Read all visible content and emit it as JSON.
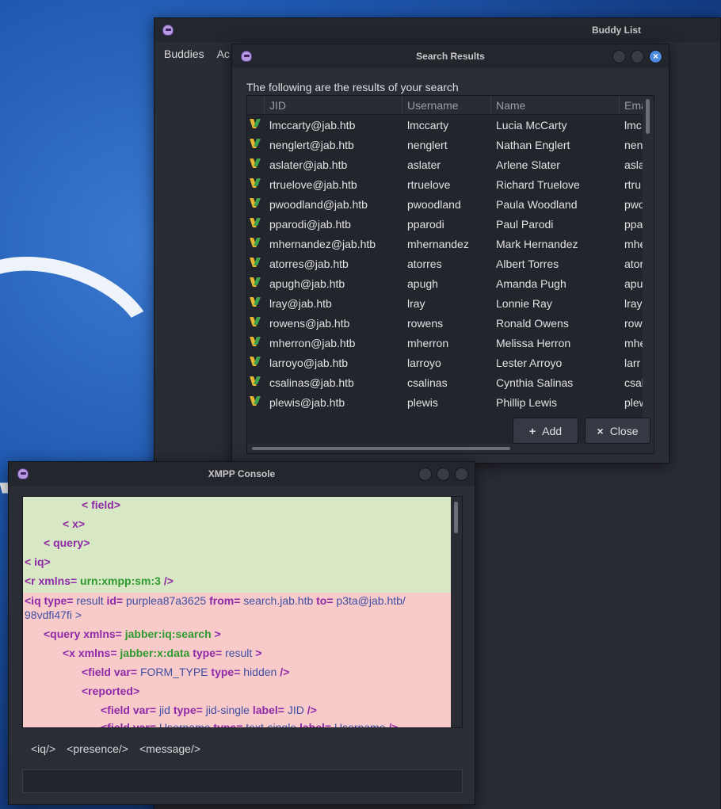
{
  "buddy_window": {
    "title": "Buddy List",
    "menu": [
      "Buddies",
      "Ac"
    ]
  },
  "search_window": {
    "title": "Search Results",
    "caption": "The following are the results of your search",
    "columns": [
      "JID",
      "Username",
      "Name",
      "Ema"
    ],
    "rows": [
      {
        "jid": "lmccarty@jab.htb",
        "username": "lmccarty",
        "name": "Lucia McCarty",
        "email": "lmc"
      },
      {
        "jid": "nenglert@jab.htb",
        "username": "nenglert",
        "name": "Nathan Englert",
        "email": "nen"
      },
      {
        "jid": "aslater@jab.htb",
        "username": "aslater",
        "name": "Arlene Slater",
        "email": "asla"
      },
      {
        "jid": "rtruelove@jab.htb",
        "username": "rtruelove",
        "name": "Richard Truelove",
        "email": "rtru"
      },
      {
        "jid": "pwoodland@jab.htb",
        "username": "pwoodland",
        "name": "Paula Woodland",
        "email": "pwo"
      },
      {
        "jid": "pparodi@jab.htb",
        "username": "pparodi",
        "name": "Paul Parodi",
        "email": "ppar"
      },
      {
        "jid": "mhernandez@jab.htb",
        "username": "mhernandez",
        "name": "Mark Hernandez",
        "email": "mhe"
      },
      {
        "jid": "atorres@jab.htb",
        "username": "atorres",
        "name": "Albert Torres",
        "email": "ator"
      },
      {
        "jid": "apugh@jab.htb",
        "username": "apugh",
        "name": "Amanda Pugh",
        "email": "apu"
      },
      {
        "jid": "lray@jab.htb",
        "username": "lray",
        "name": "Lonnie Ray",
        "email": "lray"
      },
      {
        "jid": "rowens@jab.htb",
        "username": "rowens",
        "name": "Ronald Owens",
        "email": "row"
      },
      {
        "jid": "mherron@jab.htb",
        "username": "mherron",
        "name": "Melissa Herron",
        "email": "mhe"
      },
      {
        "jid": "larroyo@jab.htb",
        "username": "larroyo",
        "name": "Lester Arroyo",
        "email": "larr"
      },
      {
        "jid": "csalinas@jab.htb",
        "username": "csalinas",
        "name": "Cynthia Salinas",
        "email": "csal"
      },
      {
        "jid": "plewis@jab.htb",
        "username": "plewis",
        "name": "Phillip Lewis",
        "email": "plew"
      }
    ],
    "add_label": "Add",
    "close_label": "Close",
    "add_glyph": "+",
    "close_glyph": "×"
  },
  "console_window": {
    "title": "XMPP Console",
    "tabs": [
      "<iq/>",
      "<presence/>",
      "<message/>"
    ],
    "log": {
      "g1": "< field>",
      "g2": "< x>",
      "g3": "< query>",
      "g4": "< iq>",
      "g5_tag": "<r xmlns=",
      "g5_val": "urn:xmpp:sm:3",
      "g5_end": "/>",
      "r1_a": "<iq type=",
      "r1_b": "result",
      "r1_c": "id=",
      "r1_d": "purplea87a3625",
      "r1_e": "from=",
      "r1_f": "search.jab.htb",
      "r1_g": "to=",
      "r1_h": "p3ta@jab.htb/",
      "r2": "98vdfi47fi >",
      "r3_a": "<query xmlns=",
      "r3_b": "jabber:iq:search",
      "r3_c": ">",
      "r4_a": "<x xmlns=",
      "r4_b": "jabber:x:data",
      "r4_c": "type=",
      "r4_d": "result",
      "r4_e": ">",
      "r5_a": "<field var=",
      "r5_b": "FORM_TYPE",
      "r5_c": "type=",
      "r5_d": "hidden",
      "r5_e": "/>",
      "r6": "<reported>",
      "r7_a": "<field var=",
      "r7_b": "jid",
      "r7_c": "type=",
      "r7_d": "jid-single",
      "r7_e": "label=",
      "r7_f": "JID",
      "r7_g": "/>",
      "r8_a": "<field var=",
      "r8_b": "Username",
      "r8_c": "type=",
      "r8_d": "text-single",
      "r8_e": "label=",
      "r8_f": "Username",
      "r8_g": "/>"
    }
  }
}
